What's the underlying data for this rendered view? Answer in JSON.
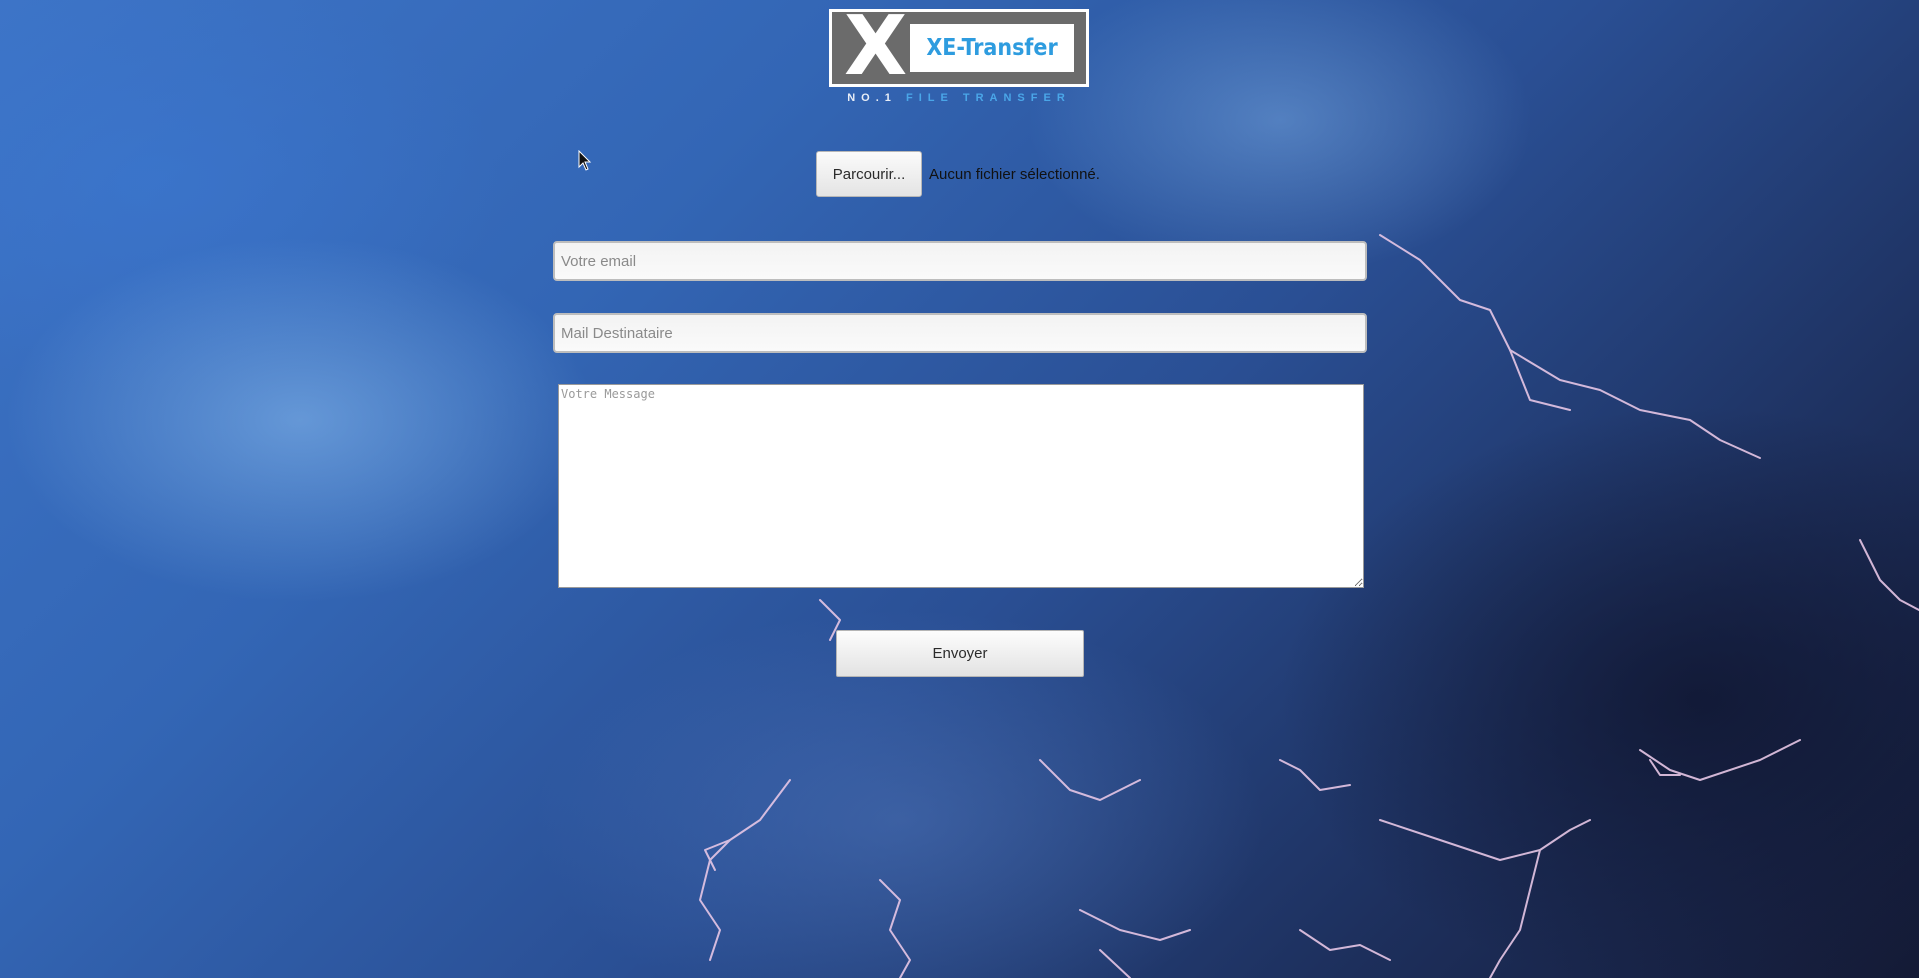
{
  "brand": {
    "logo_letter": "X",
    "logo_name": "XE-Transfer",
    "tagline_prefix": "NO.1",
    "tagline_suffix": "FILE TRANSFER"
  },
  "upload": {
    "browse_label": "Parcourir...",
    "file_status": "Aucun fichier sélectionné."
  },
  "form": {
    "email_placeholder": "Votre email",
    "email_value": "",
    "recipient_placeholder": "Mail Destinataire",
    "recipient_value": "",
    "message_placeholder": "Votre Message",
    "message_value": "",
    "submit_label": "Envoyer"
  },
  "colors": {
    "brand_blue": "#2e9cdf",
    "logo_gray": "#6b6b6b"
  },
  "background": "stormy-sky-with-lightning"
}
